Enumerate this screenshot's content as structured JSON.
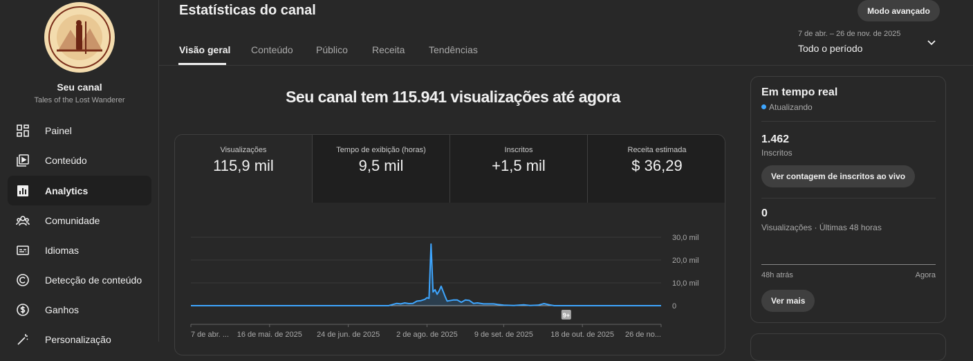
{
  "sidebar": {
    "channel_label": "Seu canal",
    "channel_name": "Tales of the Lost Wanderer",
    "logo_text": "Tales of the Lost Wanderer",
    "items": [
      {
        "label": "Painel",
        "icon": "dashboard-icon"
      },
      {
        "label": "Conteúdo",
        "icon": "content-icon"
      },
      {
        "label": "Analytics",
        "icon": "analytics-icon"
      },
      {
        "label": "Comunidade",
        "icon": "community-icon"
      },
      {
        "label": "Idiomas",
        "icon": "subtitles-icon"
      },
      {
        "label": "Detecção de conteúdo",
        "icon": "copyright-icon"
      },
      {
        "label": "Ganhos",
        "icon": "dollar-icon"
      },
      {
        "label": "Personalização",
        "icon": "magic-wand-icon"
      }
    ]
  },
  "header": {
    "title": "Estatísticas do canal",
    "advanced_button": "Modo avançado",
    "tabs": [
      "Visão geral",
      "Conteúdo",
      "Público",
      "Receita",
      "Tendências"
    ],
    "date_range": "7 de abr. – 26 de nov. de 2025",
    "period": "Todo o período"
  },
  "main": {
    "headline": "Seu canal tem 115.941 visualizações até agora",
    "metrics": [
      {
        "label": "Visualizações",
        "value": "115,9 mil"
      },
      {
        "label": "Tempo de exibição (horas)",
        "value": "9,5 mil"
      },
      {
        "label": "Inscritos",
        "value": "+1,5 mil"
      },
      {
        "label": "Receita estimada",
        "value": "$ 36,29"
      }
    ]
  },
  "chart_data": {
    "type": "area",
    "title": "Visualizações",
    "xlabel": "",
    "ylabel": "",
    "x_unit": "days since 7 de abr. de 2025",
    "xlim": [
      0,
      233
    ],
    "ylim": [
      0,
      30000
    ],
    "y_ticks": [
      {
        "v": 0,
        "label": "0"
      },
      {
        "v": 10000,
        "label": "10,0 mil"
      },
      {
        "v": 20000,
        "label": "20,0 mil"
      },
      {
        "v": 30000,
        "label": "30,0 mil"
      }
    ],
    "x_ticks": [
      {
        "d": 0,
        "label": "7 de abr. ..."
      },
      {
        "d": 39,
        "label": "16 de mai. de 2025"
      },
      {
        "d": 78,
        "label": "24 de jun. de 2025"
      },
      {
        "d": 117,
        "label": "2 de ago. de 2025"
      },
      {
        "d": 155,
        "label": "9 de set. de 2025"
      },
      {
        "d": 194,
        "label": "18 de out. de 2025"
      },
      {
        "d": 233,
        "label": "26 de no..."
      }
    ],
    "annotation": {
      "d": 186,
      "label": "9+"
    },
    "points": [
      [
        0,
        0
      ],
      [
        98,
        0
      ],
      [
        100,
        500
      ],
      [
        102,
        1000
      ],
      [
        104,
        800
      ],
      [
        106,
        1200
      ],
      [
        108,
        900
      ],
      [
        110,
        1000
      ],
      [
        112,
        2000
      ],
      [
        114,
        2200
      ],
      [
        116,
        2800
      ],
      [
        117,
        3500
      ],
      [
        118,
        3200
      ],
      [
        119,
        27000
      ],
      [
        120,
        6000
      ],
      [
        121,
        7000
      ],
      [
        122,
        5000
      ],
      [
        123,
        6500
      ],
      [
        124,
        8500
      ],
      [
        126,
        4000
      ],
      [
        127,
        2000
      ],
      [
        130,
        2500
      ],
      [
        132,
        2500
      ],
      [
        134,
        1500
      ],
      [
        136,
        2500
      ],
      [
        138,
        2300
      ],
      [
        140,
        1000
      ],
      [
        142,
        1200
      ],
      [
        145,
        800
      ],
      [
        150,
        800
      ],
      [
        152,
        500
      ],
      [
        155,
        200
      ],
      [
        160,
        100
      ],
      [
        165,
        400
      ],
      [
        168,
        100
      ],
      [
        172,
        200
      ],
      [
        175,
        900
      ],
      [
        178,
        300
      ],
      [
        180,
        0
      ],
      [
        233,
        0
      ]
    ],
    "line_color": "#3ea6ff"
  },
  "realtime": {
    "title": "Em tempo real",
    "status": "Atualizando",
    "subs_value": "1.462",
    "subs_label": "Inscritos",
    "live_button": "Ver contagem de inscritos ao vivo",
    "views_value": "0",
    "views_label": "Visualizações · Últimas 48 horas",
    "axis_start": "48h atrás",
    "axis_end": "Agora",
    "more_button": "Ver mais"
  }
}
